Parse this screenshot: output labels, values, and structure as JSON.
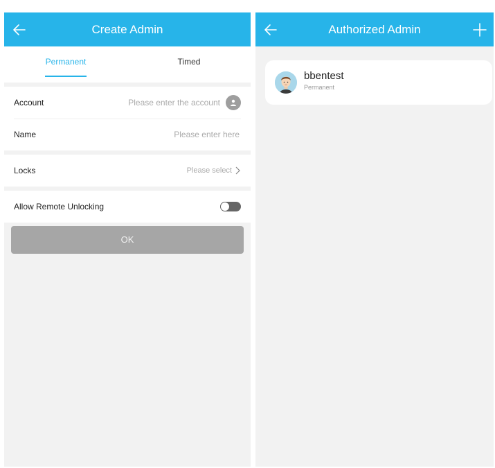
{
  "left_screen": {
    "header": {
      "title": "Create Admin",
      "back_icon": "arrow-left-icon"
    },
    "tabs": [
      {
        "label": "Permanent",
        "active": true
      },
      {
        "label": "Timed",
        "active": false
      }
    ],
    "fields": {
      "account": {
        "label": "Account",
        "placeholder": "Please enter the account",
        "icon": "contact-icon"
      },
      "name": {
        "label": "Name",
        "placeholder": "Please enter here"
      },
      "locks": {
        "label": "Locks",
        "value": "Please select",
        "icon": "chevron-right-icon"
      },
      "remote": {
        "label": "Allow Remote Unlocking",
        "enabled": false
      }
    },
    "ok_label": "OK",
    "colors": {
      "accent": "#27b4e9",
      "button_disabled": "#a6a6a6",
      "background": "#f2f2f2"
    }
  },
  "right_screen": {
    "header": {
      "title": "Authorized Admin",
      "back_icon": "arrow-left-icon",
      "add_icon": "plus-icon"
    },
    "admins": [
      {
        "name": "bbentest",
        "type": "Permanent",
        "avatar_icon": "avatar-icon"
      }
    ]
  }
}
